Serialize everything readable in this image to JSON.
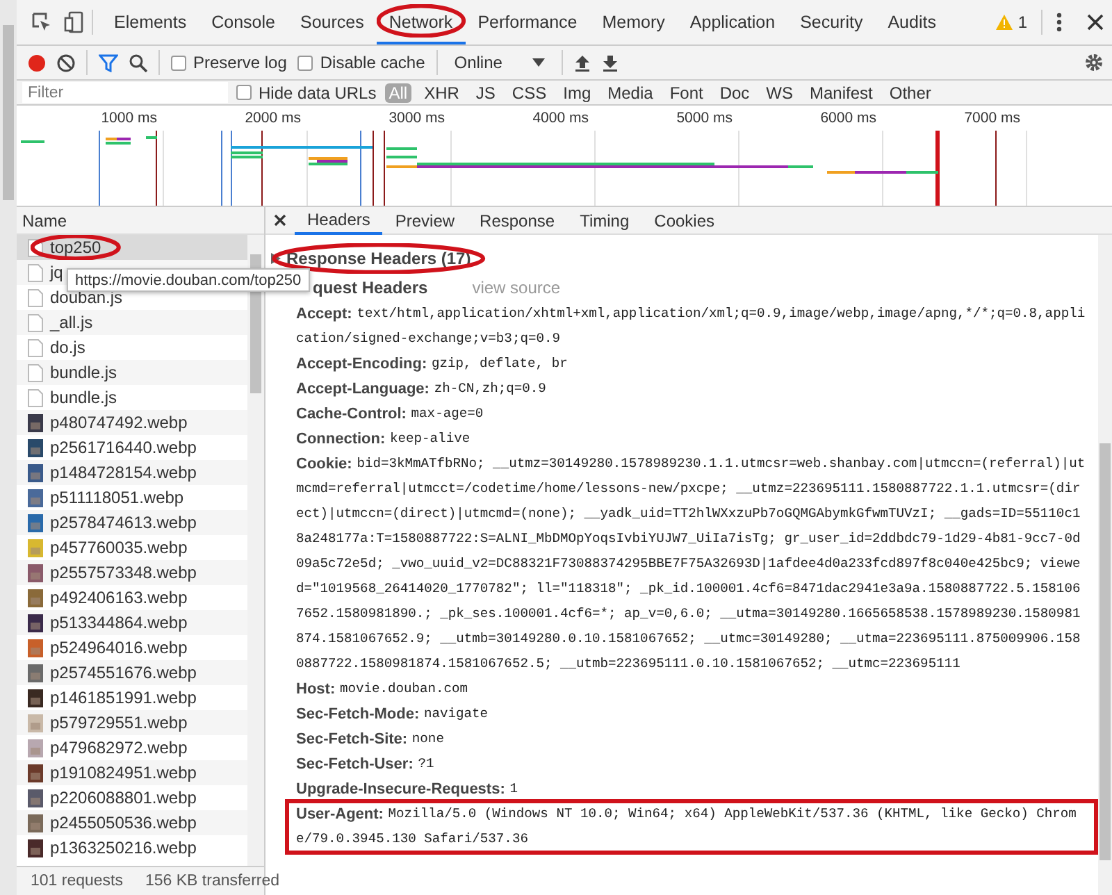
{
  "tabs": [
    {
      "label": "Elements",
      "selected": false,
      "circled": false
    },
    {
      "label": "Console",
      "selected": false,
      "circled": false
    },
    {
      "label": "Sources",
      "selected": false,
      "circled": false
    },
    {
      "label": "Network",
      "selected": true,
      "circled": true
    },
    {
      "label": "Performance",
      "selected": false,
      "circled": false
    },
    {
      "label": "Memory",
      "selected": false,
      "circled": false
    },
    {
      "label": "Application",
      "selected": false,
      "circled": false
    },
    {
      "label": "Security",
      "selected": false,
      "circled": false
    },
    {
      "label": "Audits",
      "selected": false,
      "circled": false
    }
  ],
  "warning_count": "1",
  "toolbar": {
    "recording": true,
    "preserve_log": {
      "label": "Preserve log",
      "checked": false
    },
    "disable_cache": {
      "label": "Disable cache",
      "checked": false
    },
    "throttling": "Online"
  },
  "filter": {
    "placeholder": "Filter",
    "hide_data_urls": {
      "label": "Hide data URLs",
      "checked": false
    },
    "types": [
      {
        "label": "All",
        "selected": true
      },
      {
        "label": "XHR",
        "selected": false
      },
      {
        "label": "JS",
        "selected": false
      },
      {
        "label": "CSS",
        "selected": false
      },
      {
        "label": "Img",
        "selected": false
      },
      {
        "label": "Media",
        "selected": false
      },
      {
        "label": "Font",
        "selected": false
      },
      {
        "label": "Doc",
        "selected": false
      },
      {
        "label": "WS",
        "selected": false
      },
      {
        "label": "Manifest",
        "selected": false
      },
      {
        "label": "Other",
        "selected": false
      }
    ]
  },
  "overview": {
    "ticks": [
      "1000 ms",
      "2000 ms",
      "3000 ms",
      "4000 ms",
      "5000 ms",
      "6000 ms",
      "7000 ms"
    ]
  },
  "name_column": "Name",
  "requests": [
    {
      "name": "top250",
      "kind": "document",
      "selected": true,
      "circled": true
    },
    {
      "name": "jq",
      "kind": "document",
      "selected": false,
      "circled": false
    },
    {
      "name": "douban.js",
      "kind": "document",
      "selected": false,
      "circled": false
    },
    {
      "name": "_all.js",
      "kind": "document",
      "selected": false,
      "circled": false
    },
    {
      "name": "do.js",
      "kind": "document",
      "selected": false,
      "circled": false
    },
    {
      "name": "bundle.js",
      "kind": "document",
      "selected": false,
      "circled": false
    },
    {
      "name": "bundle.js",
      "kind": "document",
      "selected": false,
      "circled": false
    },
    {
      "name": "p480747492.webp",
      "kind": "image",
      "selected": false,
      "circled": false
    },
    {
      "name": "p2561716440.webp",
      "kind": "image",
      "selected": false,
      "circled": false
    },
    {
      "name": "p1484728154.webp",
      "kind": "image",
      "selected": false,
      "circled": false
    },
    {
      "name": "p511118051.webp",
      "kind": "image",
      "selected": false,
      "circled": false
    },
    {
      "name": "p2578474613.webp",
      "kind": "image",
      "selected": false,
      "circled": false
    },
    {
      "name": "p457760035.webp",
      "kind": "image",
      "selected": false,
      "circled": false
    },
    {
      "name": "p2557573348.webp",
      "kind": "image",
      "selected": false,
      "circled": false
    },
    {
      "name": "p492406163.webp",
      "kind": "image",
      "selected": false,
      "circled": false
    },
    {
      "name": "p513344864.webp",
      "kind": "image",
      "selected": false,
      "circled": false
    },
    {
      "name": "p524964016.webp",
      "kind": "image",
      "selected": false,
      "circled": false
    },
    {
      "name": "p2574551676.webp",
      "kind": "image",
      "selected": false,
      "circled": false
    },
    {
      "name": "p1461851991.webp",
      "kind": "image",
      "selected": false,
      "circled": false
    },
    {
      "name": "p579729551.webp",
      "kind": "image",
      "selected": false,
      "circled": false
    },
    {
      "name": "p479682972.webp",
      "kind": "image",
      "selected": false,
      "circled": false
    },
    {
      "name": "p1910824951.webp",
      "kind": "image",
      "selected": false,
      "circled": false
    },
    {
      "name": "p2206088801.webp",
      "kind": "image",
      "selected": false,
      "circled": false
    },
    {
      "name": "p2455050536.webp",
      "kind": "image",
      "selected": false,
      "circled": false
    },
    {
      "name": "p1363250216.webp",
      "kind": "image",
      "selected": false,
      "circled": false
    }
  ],
  "tooltip": "https://movie.douban.com/top250",
  "status_bar": {
    "requests": "101 requests",
    "transferred": "156 KB transferred"
  },
  "detail_tabs": [
    {
      "label": "Headers",
      "selected": true
    },
    {
      "label": "Preview",
      "selected": false
    },
    {
      "label": "Response",
      "selected": false
    },
    {
      "label": "Timing",
      "selected": false
    },
    {
      "label": "Cookies",
      "selected": false
    }
  ],
  "sections": [
    {
      "title": "Response Headers (17)",
      "expanded": false,
      "circled": true
    },
    {
      "title": "quest Headers",
      "expanded": true,
      "circled": false,
      "action": "view source",
      "headers": [
        {
          "name": "Accept:",
          "value": "text/html,application/xhtml+xml,application/xml;q=0.9,image/webp,image/apng,*/*;q=0.8,application/signed-exchange;v=b3;q=0.9",
          "boxed": false
        },
        {
          "name": "Accept-Encoding:",
          "value": "gzip, deflate, br",
          "boxed": false
        },
        {
          "name": "Accept-Language:",
          "value": "zh-CN,zh;q=0.9",
          "boxed": false
        },
        {
          "name": "Cache-Control:",
          "value": "max-age=0",
          "boxed": false
        },
        {
          "name": "Connection:",
          "value": "keep-alive",
          "boxed": false
        },
        {
          "name": "Cookie:",
          "value": "bid=3kMmATfbRNo; __utmz=30149280.1578989230.1.1.utmcsr=web.shanbay.com|utmccn=(referral)|utmcmd=referral|utmcct=/codetime/home/lessons-new/pxcpe; __utmz=223695111.1580887722.1.1.utmcsr=(direct)|utmccn=(direct)|utmcmd=(none); __yadk_uid=TT2hlWXxzuPb7oGQMGAbymkGfwmTUVzI; __gads=ID=55110c18a248177a:T=1580887722:S=ALNI_MbDMOpYoqsIvbiYUJW7_UiIa7isTg; gr_user_id=2ddbdc79-1d29-4b81-9cc7-0d09a5c72e5d; _vwo_uuid_v2=DC88321F73088374295BBE7F75A32693D|1afdee4d0a233fcd897f8c040e425bc9; viewed=\"1019568_26414020_1770782\"; ll=\"118318\"; _pk_id.100001.4cf6=8471dac2941e3a9a.1580887722.5.1581067652.1580981890.; _pk_ses.100001.4cf6=*; ap_v=0,6.0; __utma=30149280.1665658538.1578989230.1580981874.1581067652.9; __utmb=30149280.0.10.1581067652; __utmc=30149280; __utma=223695111.875009906.1580887722.1580981874.1581067652.5; __utmb=223695111.0.10.1581067652; __utmc=223695111",
          "boxed": false
        },
        {
          "name": "Host:",
          "value": "movie.douban.com",
          "boxed": false
        },
        {
          "name": "Sec-Fetch-Mode:",
          "value": "navigate",
          "boxed": false
        },
        {
          "name": "Sec-Fetch-Site:",
          "value": "none",
          "boxed": false
        },
        {
          "name": "Sec-Fetch-User:",
          "value": "?1",
          "boxed": false
        },
        {
          "name": "Upgrade-Insecure-Requests:",
          "value": "1",
          "boxed": false
        },
        {
          "name": "User-Agent:",
          "value": "Mozilla/5.0 (Windows NT 10.0; Win64; x64) AppleWebKit/537.36 (KHTML, like Gecko) Chrome/79.0.3945.130 Safari/537.36",
          "boxed": true
        }
      ]
    }
  ]
}
